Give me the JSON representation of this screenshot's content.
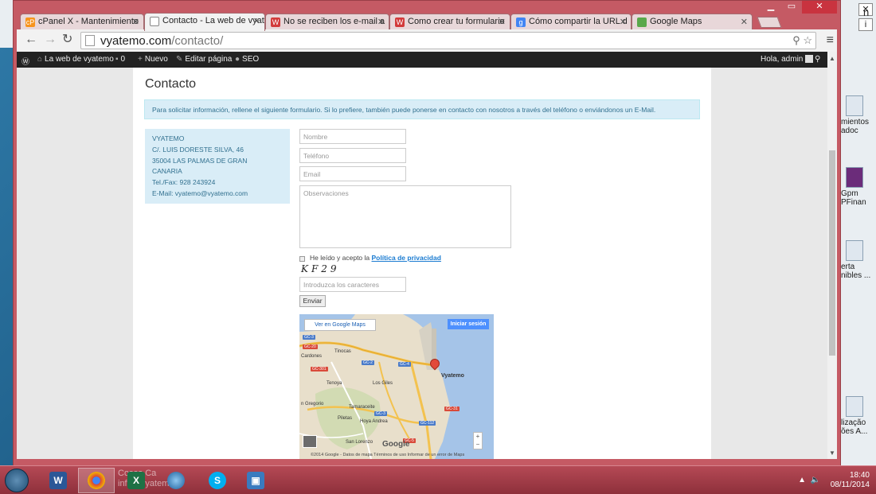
{
  "desktop": {
    "right_icons": [
      {
        "label": "mientos",
        "label2": "adoc"
      },
      {
        "label": "Gpm",
        "label2": "PFinan"
      },
      {
        "label": "erta",
        "label2": "nibles ..."
      },
      {
        "label": "lização",
        "label2": "ões A..."
      }
    ],
    "corner_char": "n",
    "buttons": [
      "✕",
      "i"
    ]
  },
  "browser": {
    "tabs": [
      {
        "label": "cPanel X - Mantenimiento",
        "favicon": "cpanel-icon",
        "favicon_text": "cP"
      },
      {
        "label": "Contacto - La web de vyatemo",
        "favicon": "page-icon",
        "favicon_text": ""
      },
      {
        "label": "No se reciben los e-mail a",
        "favicon": "w-icon",
        "favicon_text": "W"
      },
      {
        "label": "Como crear tu formulario",
        "favicon": "w-icon",
        "favicon_text": "W"
      },
      {
        "label": "Cómo compartir la URL d",
        "favicon": "google-icon",
        "favicon_text": "g"
      },
      {
        "label": "Google Maps",
        "favicon": "maps-icon",
        "favicon_text": ""
      }
    ],
    "url_host": "vyatemo.com",
    "url_path": "/contacto/"
  },
  "adminbar": {
    "site": "La web de vyatemo",
    "comments": "0",
    "new": "Nuevo",
    "edit": "Editar página",
    "seo": "SEO",
    "greeting": "Hola, admin"
  },
  "page": {
    "title": "Contacto",
    "notice": "Para solicitar información, rellene el siguiente formulario. Si lo prefiere, también puede ponerse en contacto con nosotros a través del teléfono o enviándonos un E-Mail.",
    "address": {
      "name": "VYATEMO",
      "street": "C/. LUIS DORESTE SILVA, 46",
      "city": "35004 LAS PALMAS DE GRAN",
      "region": "CANARIA",
      "phone": "Tel./Fax: 928 243924",
      "email": "E-Mail: vyatemo@vyatemo.com"
    },
    "form": {
      "name_placeholder": "Nombre",
      "phone_placeholder": "Teléfono",
      "email_placeholder": "Email",
      "notes_placeholder": "Observaciones",
      "privacy_text": "He leído y acepto la",
      "privacy_link": "Política de privacidad",
      "captcha": "KF29",
      "captcha_placeholder": "Introduzca los caracteres",
      "submit": "Enviar"
    },
    "map": {
      "view_button": "Ver en Google Maps",
      "signin": "Iniciar sesión",
      "marker_label": "Vyatemo",
      "places": [
        "Tinocas",
        "Cardones",
        "Tenoya",
        "Los Giles",
        "Tamaraceite",
        "Piletas",
        "Hoya Andrea",
        "San Lorenzo",
        "n Gregorio",
        "Google"
      ],
      "roads": [
        "GC-3",
        "GC-20",
        "GC-2",
        "GC-301",
        "GC-4",
        "GC-3",
        "GC-112",
        "GC-5",
        "GC-31"
      ],
      "footer": "©2014 Google - Datos de mapa    Términos de uso    Informar de un error de Maps",
      "zoom_in": "+",
      "zoom_out": "−"
    }
  },
  "taskbar": {
    "ghost_text_1": "Cosas Ca",
    "ghost_text_2": "info@vyatem",
    "time": "18:40",
    "date": "08/11/2014"
  }
}
